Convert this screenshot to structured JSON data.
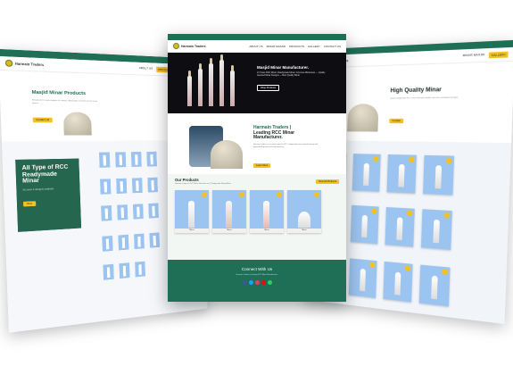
{
  "colors": {
    "brand_green": "#1f6e56",
    "accent_yellow": "#f3c220",
    "card_blue": "#9cc4f0"
  },
  "site": {
    "logo_text": "Harmain Traders",
    "menu": [
      "ABOUT US",
      "MINAR MASJID",
      "PRODUCTS",
      "GALLERY",
      "CONTACT US"
    ]
  },
  "center": {
    "hero": {
      "title": "Masjid Minar Manufacturer.",
      "desc": "21 Years RCC Minar, Readymade Minar, Concrete Minarettes — Quality Assured Minar Designs — Best Quality Minar",
      "button": "Shop Products"
    },
    "about": {
      "title_line1": "Harmain Traders |",
      "title_line2": "Leading RCC Minar",
      "title_line3": "Manufacturer.",
      "text": "Harmain Traders is a trusted name for RCC readymade minar manufacturing with dependable quality and timely delivery.",
      "button": "Learn More"
    },
    "products": {
      "title": "Our Products",
      "sub": "Harmain Traders | RCC Minar Manufacturer | Readymade Masjid Minar",
      "button": "View All Products",
      "cards": [
        "Minar",
        "Minar",
        "Minar",
        "Minar"
      ]
    },
    "footer": {
      "title": "Connect With Us",
      "text": "Harmain Traders | Leading RCC Minar Manufacturer"
    }
  },
  "left": {
    "title": "Masjid Minar Products",
    "desc": "Browse RCC minar designs for masjid, readymade minarets and concrete towers.",
    "button": "Contact Us",
    "promo_title": "All Type of RCC Readymade Minar",
    "promo_sub": "All sizes & designs available",
    "promo_button": "View"
  },
  "right": {
    "title": "High Quality Minar",
    "desc": "Quality readymade RCC minar built with durable concrete and elegant designs.",
    "button": "Contact"
  }
}
